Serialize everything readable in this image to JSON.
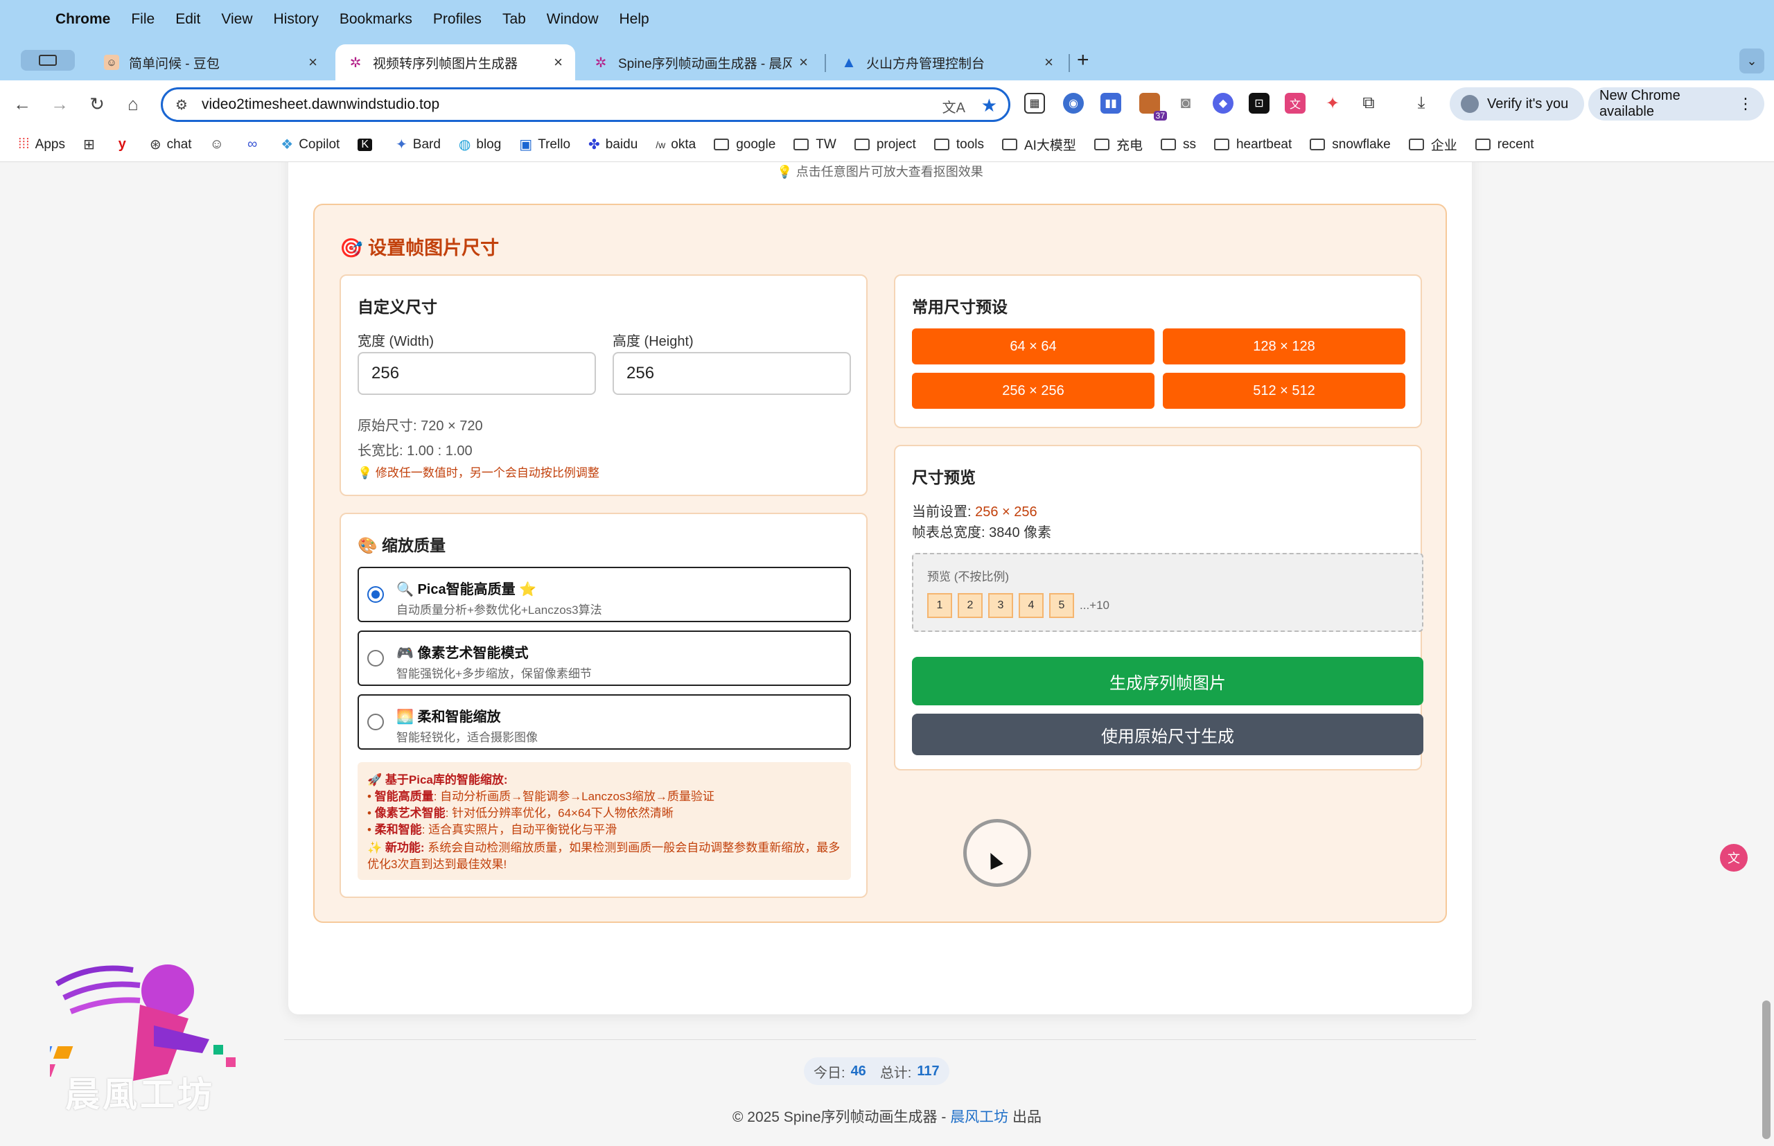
{
  "menubar": {
    "app": "Chrome",
    "items": [
      "File",
      "Edit",
      "View",
      "History",
      "Bookmarks",
      "Profiles",
      "Tab",
      "Window",
      "Help"
    ]
  },
  "tabs": [
    {
      "title": "简单问候 - 豆包",
      "active": false
    },
    {
      "title": "视频转序列帧图片生成器",
      "active": true
    },
    {
      "title": "Spine序列帧动画生成器 - 晨风工",
      "active": false
    },
    {
      "title": "火山方舟管理控制台",
      "active": false
    }
  ],
  "toolbar": {
    "url": "video2timesheet.dawnwindstudio.top",
    "ext_badge": "37",
    "verify_label": "Verify it's you",
    "update_label": "New Chrome available"
  },
  "bookmarks": [
    "Apps",
    "chat",
    "Copilot",
    "Bard",
    "blog",
    "Trello",
    "baidu",
    "okta",
    "google",
    "TW",
    "project",
    "tools",
    "AI大模型",
    "充电",
    "ss",
    "heartbeat",
    "snowflake",
    "企业",
    "recent"
  ],
  "page": {
    "top_hint": "💡 点击任意图片可放大查看抠图效果",
    "settings_title": "🎯 设置帧图片尺寸",
    "custom": {
      "title": "自定义尺寸",
      "width_label": "宽度 (Width)",
      "height_label": "高度 (Height)",
      "width_value": "256",
      "height_value": "256",
      "original": "原始尺寸: 720 × 720",
      "ratio": "长宽比: 1.00 : 1.00",
      "tip": "💡 修改任一数值时，另一个会自动按比例调整"
    },
    "presets": {
      "title": "常用尺寸预设",
      "items": [
        "64 × 64",
        "128 × 128",
        "256 × 256",
        "512 × 512"
      ]
    },
    "quality": {
      "title": "🎨 缩放质量",
      "options": [
        {
          "title": "🔍 Pica智能高质量 ⭐",
          "desc": "自动质量分析+参数优化+Lanczos3算法",
          "selected": true
        },
        {
          "title": "🎮 像素艺术智能模式",
          "desc": "智能强锐化+多步缩放，保留像素细节",
          "selected": false
        },
        {
          "title": "🌅 柔和智能缩放",
          "desc": "智能轻锐化，适合摄影图像",
          "selected": false
        }
      ],
      "info_head": "🚀 基于Pica库的智能缩放:",
      "info_lines": [
        {
          "k": "智能高质量",
          "v": ": 自动分析画质→智能调参→Lanczos3缩放→质量验证"
        },
        {
          "k": "像素艺术智能",
          "v": ": 针对低分辨率优化，64×64下人物依然清晰"
        },
        {
          "k": "柔和智能",
          "v": ": 适合真实照片，自动平衡锐化与平滑"
        }
      ],
      "new_k": "✨ 新功能:",
      "new_v": " 系统会自动检测缩放质量，如果检测到画质一般会自动调整参数重新缩放，最多优化3次直到达到最佳效果!"
    },
    "preview": {
      "title": "尺寸预览",
      "current_label": "当前设置: ",
      "current_value": "256 × 256",
      "total": "帧表总宽度: 3840 像素",
      "box_label": "预览 (不按比例)",
      "frames": [
        "1",
        "2",
        "3",
        "4",
        "5"
      ],
      "more": "...+10",
      "generate": "生成序列帧图片",
      "original": "使用原始尺寸生成"
    },
    "footer": {
      "today_label": "今日:",
      "today_value": "46",
      "total_label": "总计:",
      "total_value": "117",
      "copyright_pre": "© 2025 Spine序列帧动画生成器 - ",
      "brand": "晨风工坊",
      "copyright_post": " 出品",
      "logo_text": "晨風工坊"
    }
  },
  "colors": {
    "accent_orange": "#ff5f00",
    "generate_green": "#16a34a",
    "original_gray": "#4b5563"
  }
}
